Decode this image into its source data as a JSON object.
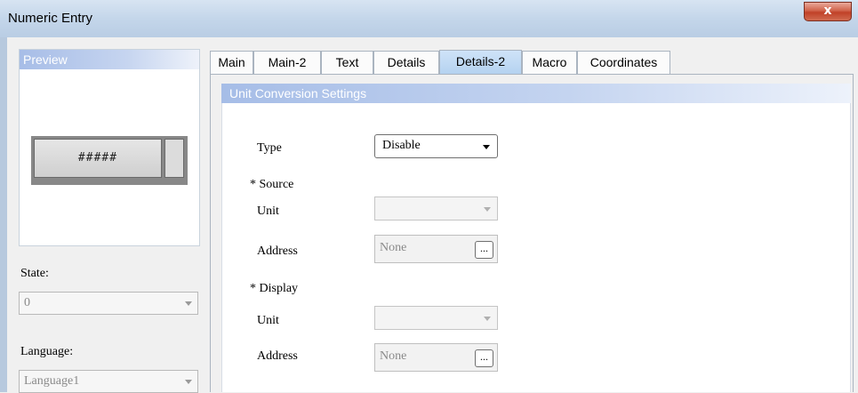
{
  "window": {
    "title": "Numeric Entry",
    "close_symbol": "x"
  },
  "preview": {
    "header": "Preview",
    "button_text": "#####"
  },
  "state": {
    "label": "State:",
    "value": "0"
  },
  "language": {
    "label": "Language:",
    "value": "Language1"
  },
  "tabs": [
    {
      "label": "Main"
    },
    {
      "label": "Main-2"
    },
    {
      "label": "Text"
    },
    {
      "label": "Details"
    },
    {
      "label": "Details-2"
    },
    {
      "label": "Macro"
    },
    {
      "label": "Coordinates"
    }
  ],
  "active_tab": "Details-2",
  "unit_conversion": {
    "header": "Unit Conversion Settings",
    "type_label": "Type",
    "type_value": "Disable",
    "source_label": "* Source",
    "source_unit_label": "Unit",
    "source_address_label": "Address",
    "source_address_value": "None",
    "display_label": "* Display",
    "display_unit_label": "Unit",
    "display_address_label": "Address",
    "display_address_value": "None",
    "browse_label": "..."
  }
}
